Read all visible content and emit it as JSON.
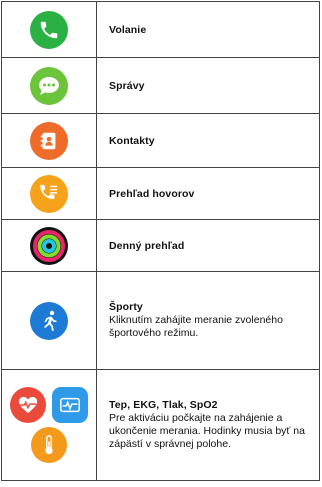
{
  "rows": [
    {
      "icon": "phone-icon",
      "title": "Volanie",
      "desc": ""
    },
    {
      "icon": "messages-icon",
      "title": "Správy",
      "desc": ""
    },
    {
      "icon": "contacts-icon",
      "title": "Kontakty",
      "desc": ""
    },
    {
      "icon": "call-log-icon",
      "title": "Prehľad hovorov",
      "desc": ""
    },
    {
      "icon": "activity-rings-icon",
      "title": "Denný prehľad",
      "desc": ""
    },
    {
      "icon": "running-icon",
      "title": "Športy",
      "desc": "Kliknutím zahájite meranie zvoleného športového režimu."
    },
    {
      "icon": "heart-rate-ekg-temperature-icons",
      "title": "Tep, EKG, Tlak, SpO2",
      "desc": "Pre aktiváciu počkajte na zahájenie a ukončenie merania. Hodinky musia byť na zápästí v správnej polohe."
    }
  ],
  "colors": {
    "phone": "#2ab043",
    "messages": "#6cc43a",
    "contacts": "#ee6b2a",
    "calllog": "#f7a21b",
    "sports": "#1d7bd6",
    "heart": "#ea4a3a",
    "ekg": "#2e9ae8",
    "temp": "#f39a1d"
  }
}
